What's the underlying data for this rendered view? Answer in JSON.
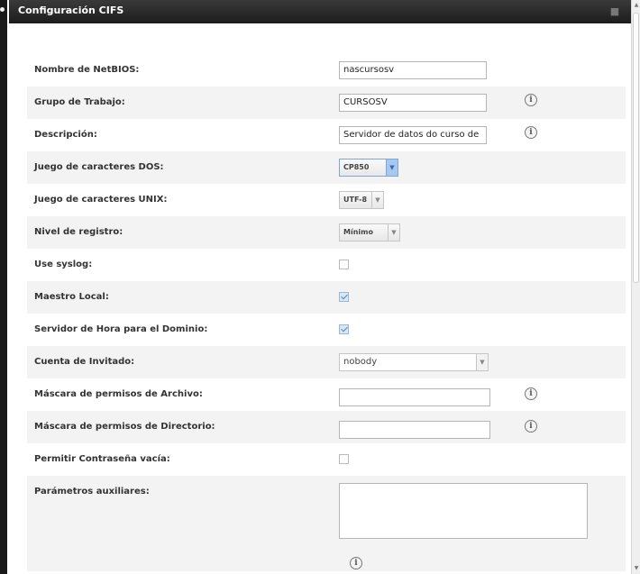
{
  "dialog": {
    "title": "Configuración CIFS",
    "close_icon": "close-icon"
  },
  "fields": {
    "netbios": {
      "label": "Nombre de NetBIOS:",
      "value": "nascursosv"
    },
    "workgroup": {
      "label": "Grupo de Trabajo:",
      "value": "CURSOSV"
    },
    "description": {
      "label": "Descripción:",
      "value": "Servidor de datos do curso de"
    },
    "dos_charset": {
      "label": "Juego de caracteres DOS:",
      "value": "CP850"
    },
    "unix_charset": {
      "label": "Juego de caracteres UNIX:",
      "value": "UTF-8"
    },
    "log_level": {
      "label": "Nivel de registro:",
      "value": "Mínimo"
    },
    "use_syslog": {
      "label": "Use syslog:",
      "checked": false
    },
    "local_master": {
      "label": "Maestro Local:",
      "checked": true
    },
    "time_server": {
      "label": "Servidor de Hora para el Dominio:",
      "checked": true
    },
    "guest_account": {
      "label": "Cuenta de Invitado:",
      "value": "nobody"
    },
    "file_mask": {
      "label": "Máscara de permisos de Archivo:",
      "value": ""
    },
    "dir_mask": {
      "label": "Máscara de permisos de Directorio:",
      "value": ""
    },
    "empty_password": {
      "label": "Permitir Contraseña vacía:",
      "checked": false
    },
    "aux_params": {
      "label": "Parámetros auxiliares:",
      "value": ""
    }
  },
  "icons": {
    "info": "info-icon",
    "info_glyph": "i"
  },
  "colors": {
    "title_bar": "#262626",
    "row_alt": "#f3f3f3",
    "select_focus": "#a9c8ee"
  }
}
